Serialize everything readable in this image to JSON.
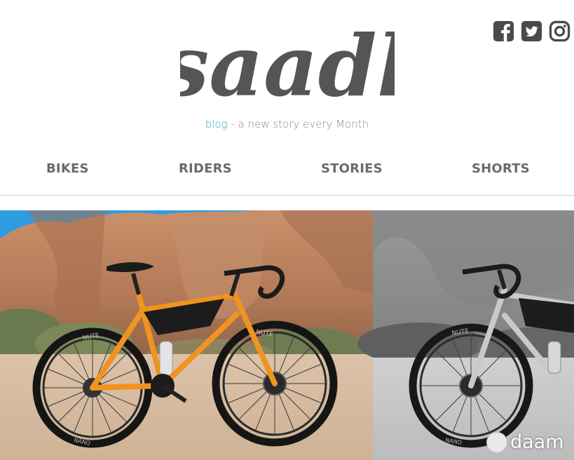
{
  "brand": {
    "logo_text": "saadl",
    "tagline_link": "blog",
    "tagline_rest": " - a new story every Month"
  },
  "social": [
    {
      "name": "facebook-icon"
    },
    {
      "name": "twitter-icon"
    },
    {
      "name": "instagram-icon"
    }
  ],
  "nav": {
    "items": [
      "BIKES",
      "RIDERS",
      "STORIES",
      "SHORTS"
    ]
  },
  "hero": {
    "tire_brand_left": "NUTE",
    "tire_brand_right": "NUTE",
    "tire_text_left": "NANO",
    "tire_text_right": "NANO"
  },
  "watermark": {
    "text": "daam"
  },
  "colors": {
    "logo": "#555555",
    "tagline_link": "#3aa3d6",
    "tagline_text": "#8a8a8a",
    "nav_text": "#6b6b6b",
    "frame_orange": "#f0931f"
  }
}
